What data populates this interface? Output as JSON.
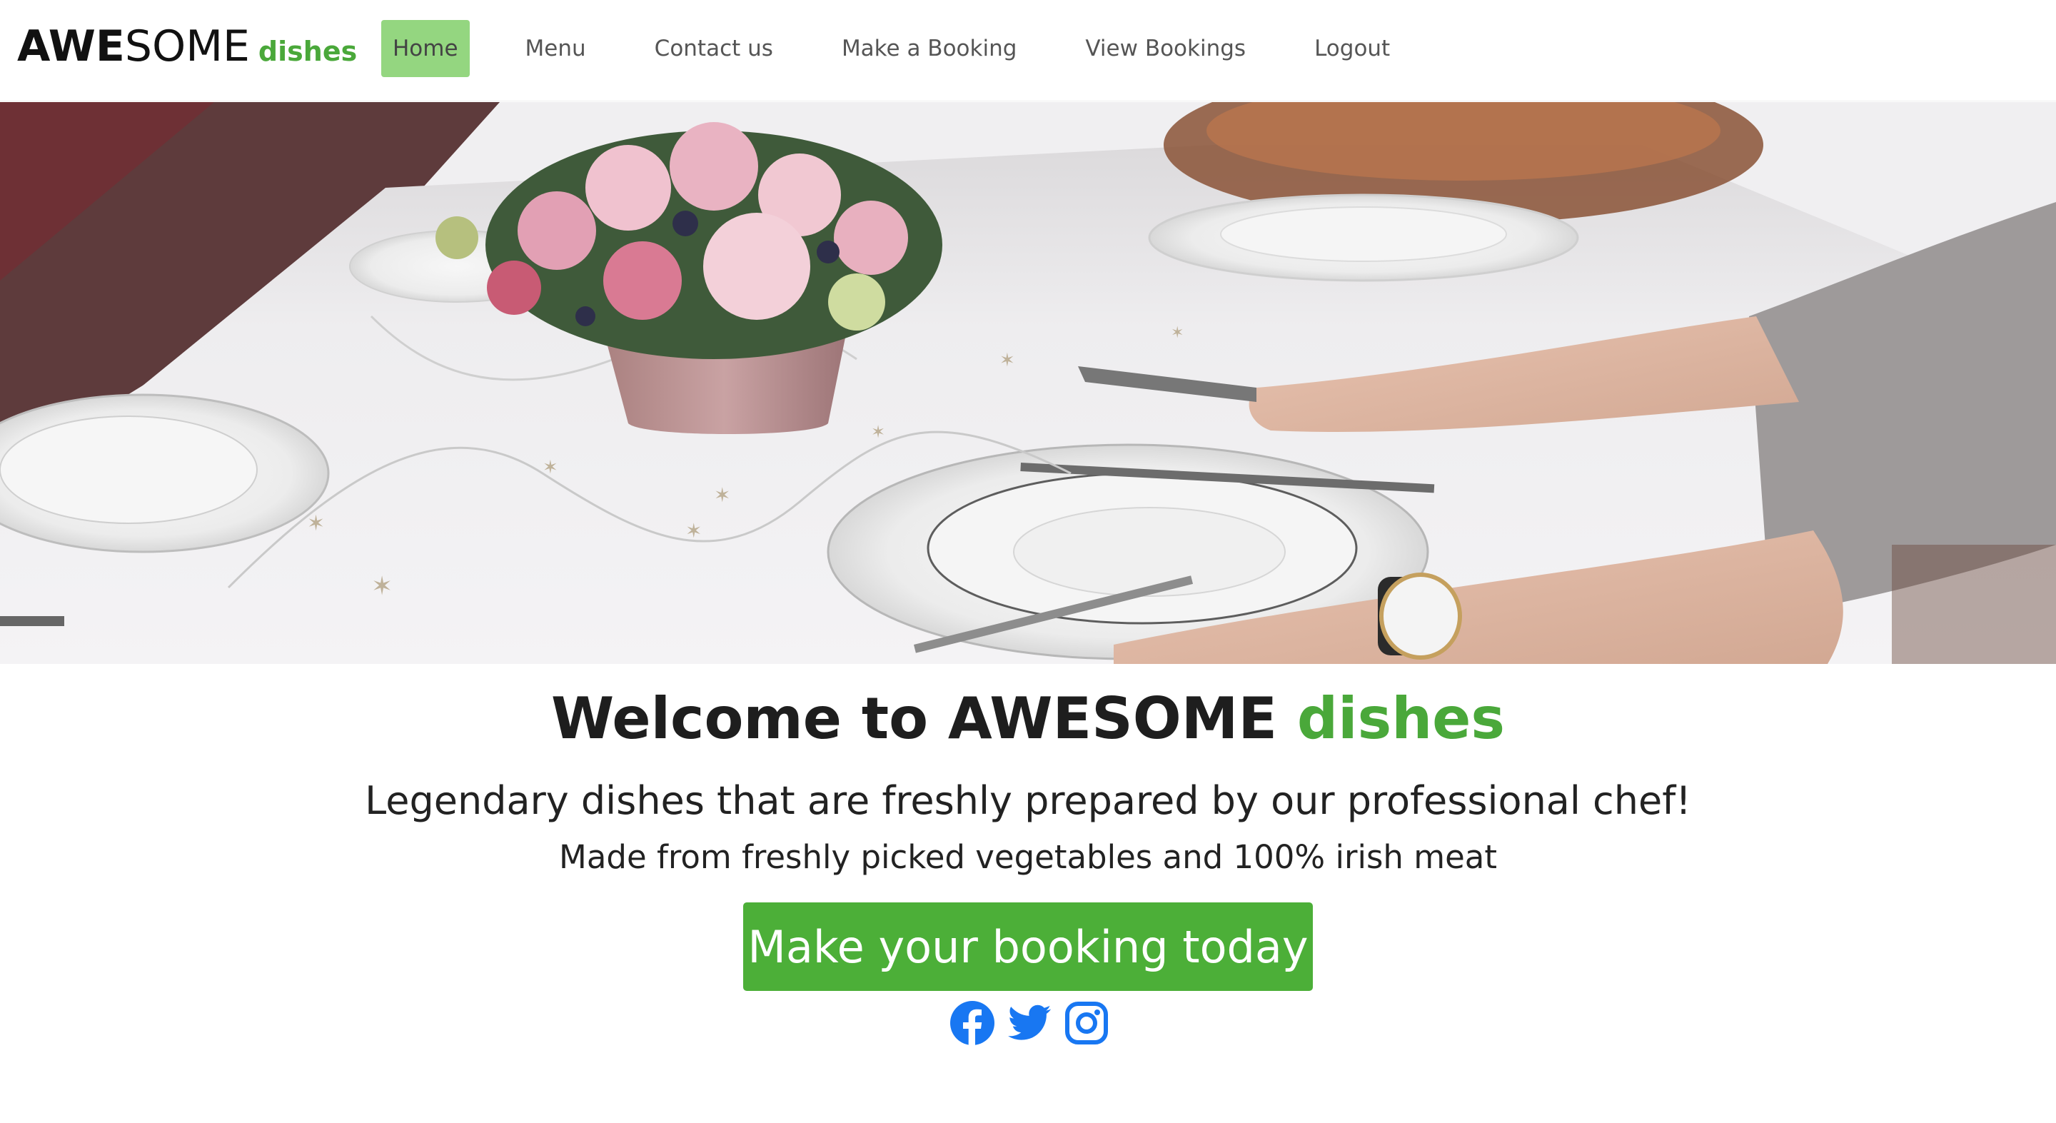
{
  "navbar": {
    "brand_bold": "AWE",
    "brand_light": "SOME",
    "brand_sub": "dishes",
    "items": [
      {
        "label": "Home",
        "active": true
      },
      {
        "label": "Menu"
      },
      {
        "label": "Contact us"
      },
      {
        "label": "Make a Booking"
      },
      {
        "label": "View Bookings"
      },
      {
        "label": "Logout"
      }
    ]
  },
  "hero": {
    "image": "dinner-table-setting-photo"
  },
  "main": {
    "welcome_prefix": "Welcome to AWESOME",
    "welcome_green": "dishes",
    "tagline": "Legendary dishes that are freshly prepared by our professional chef!",
    "subline": "Made from freshly picked vegetables and 100% irish meat",
    "cta_label": "Make your booking today"
  },
  "social": [
    {
      "icon": "facebook-icon"
    },
    {
      "icon": "twitter-icon"
    },
    {
      "icon": "instagram-icon"
    }
  ],
  "colors": {
    "accent_green": "#4caf38",
    "nav_active_bg": "#94d680",
    "social_blue": "#1877f2"
  }
}
